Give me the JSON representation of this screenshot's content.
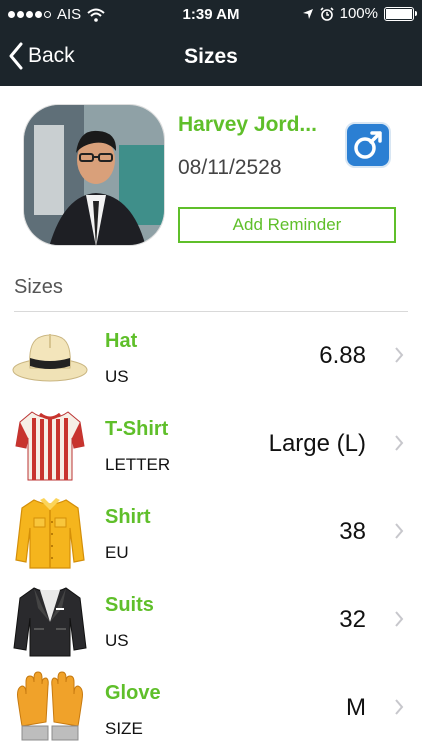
{
  "status_bar": {
    "carrier": "AIS",
    "time": "1:39 AM",
    "battery": "100%",
    "battery_level": 1.0
  },
  "nav": {
    "back_label": "Back",
    "title": "Sizes"
  },
  "profile": {
    "name": "Harvey Jord...",
    "date": "08/11/2528",
    "gender_icon": "male-symbol-icon",
    "reminder_label": "Add Reminder"
  },
  "section": {
    "title": "Sizes"
  },
  "items": [
    {
      "label": "Hat",
      "unit": "US",
      "value": "6.88",
      "icon": "hat-icon"
    },
    {
      "label": "T-Shirt",
      "unit": "LETTER",
      "value": "Large (L)",
      "icon": "tshirt-icon"
    },
    {
      "label": "Shirt",
      "unit": "EU",
      "value": "38",
      "icon": "shirt-icon"
    },
    {
      "label": "Suits",
      "unit": "US",
      "value": "32",
      "icon": "suit-icon"
    },
    {
      "label": "Glove",
      "unit": "SIZE",
      "value": "M",
      "icon": "glove-icon"
    }
  ],
  "colors": {
    "accent": "#5fbf2a",
    "nav_bg": "#1c252b",
    "gender_blue": "#2b7fd3"
  }
}
